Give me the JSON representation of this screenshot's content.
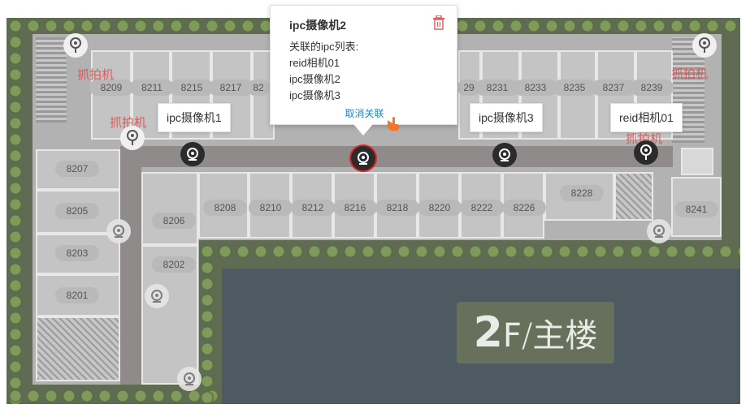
{
  "popup": {
    "title": "ipc摄像机2",
    "list_heading": "关联的ipc列表:",
    "items": [
      "reid相机01",
      "ipc摄像机2",
      "ipc摄像机3"
    ],
    "unlink_label": "取消关联",
    "delete_icon": "trash-icon"
  },
  "tags": {
    "ipc1": "ipc摄像机1",
    "ipc3": "ipc摄像机3",
    "reid01": "reid相机01"
  },
  "map_labels": {
    "capture_left_top": "抓拍机",
    "capture_left_mid": "抓拍机",
    "capture_right_top": "抓拍机",
    "capture_right_mid": "抓拍机"
  },
  "floor_sign": {
    "number": "2",
    "unit": "F",
    "separator": "/",
    "building": "主楼"
  },
  "rooms": {
    "r8209": "8209",
    "r8211": "8211",
    "r8215": "8215",
    "r8217": "8217",
    "r82x": "82",
    "r8229": "29",
    "r8231": "8231",
    "r8233": "8233",
    "r8235": "8235",
    "r8237": "8237",
    "r8239": "8239",
    "r8207": "8207",
    "r8205": "8205",
    "r8203": "8203",
    "r8201": "8201",
    "r8206": "8206",
    "r8202": "8202",
    "r8208": "8208",
    "r8210": "8210",
    "r8212": "8212",
    "r8216": "8216",
    "r8218": "8218",
    "r8220": "8220",
    "r8222": "8222",
    "r8226": "8226",
    "r8228": "8228",
    "r8241": "8241"
  },
  "colors": {
    "selected_ring": "#d9272e",
    "link": "#1a8ad4",
    "capture_text": "#e04a4a",
    "water": "#4d5a61",
    "grass": "#5f6b52"
  }
}
